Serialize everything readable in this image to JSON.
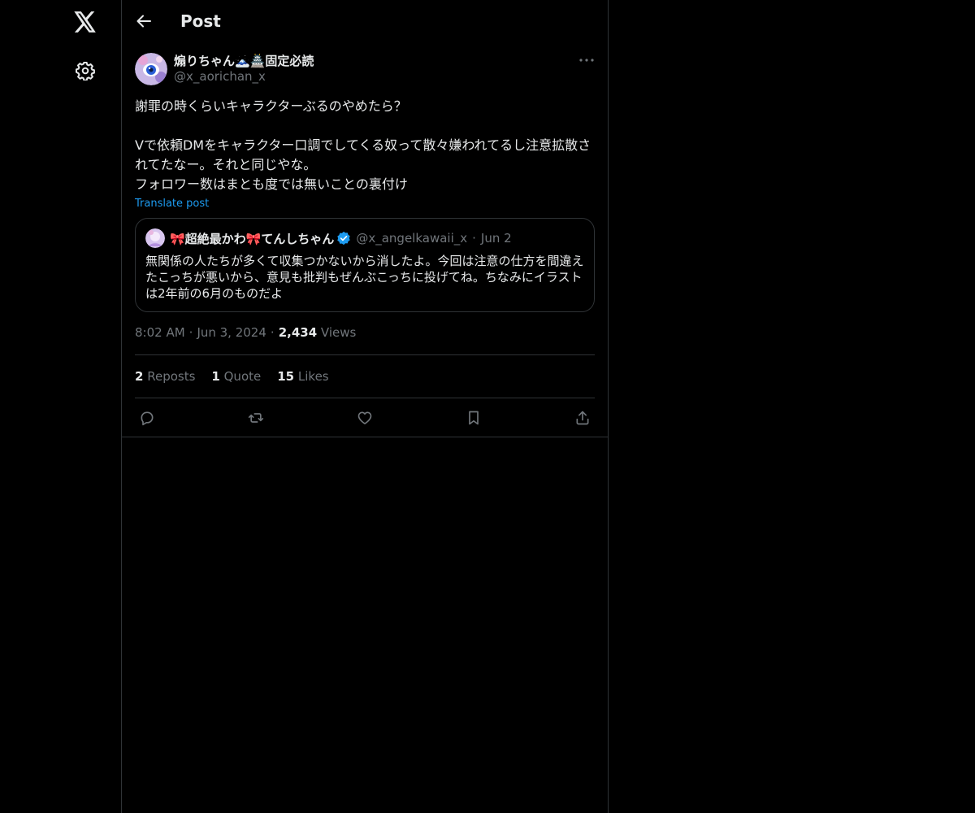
{
  "header": {
    "title": "Post"
  },
  "post": {
    "author_name": "煽りちゃん🗻🏯固定必読",
    "author_handle": "@x_aorichan_x",
    "text": "謝罪の時くらいキャラクターぶるのやめたら？\n\nVで依頼DMをキャラクター口調でしてくる奴って散々嫌われてるし注意拡散されてたなー。それと同じやな。\nフォロワー数はまとも度では無いことの裏付け",
    "translate_label": "Translate post",
    "time": "8:02 AM",
    "date": "Jun 3, 2024",
    "views_count": "2,434",
    "views_label": "Views"
  },
  "quote": {
    "author_name": "🎀超絶最かわ🎀てんしちゃん",
    "author_handle": "@x_angelkawaii_x",
    "dot": "·",
    "date": "Jun 2",
    "text": "無関係の人たちが多くて収集つかないから消したよ。今回は注意の仕方を間違えたこっちが悪いから、意見も批判もぜんぶこっちに投げてね。ちなみにイラストは2年前の6月のものだよ"
  },
  "stats": {
    "reposts_count": "2",
    "reposts_label": "Reposts",
    "quotes_count": "1",
    "quotes_label": "Quote",
    "likes_count": "15",
    "likes_label": "Likes"
  },
  "meta_sep": "·",
  "colors": {
    "background": "#000000",
    "accent": "#1d9bf0",
    "border": "#2f3336",
    "muted": "#71767b",
    "text": "#e7e9ea"
  },
  "icons": [
    "x-logo-icon",
    "gear-icon",
    "back-arrow-icon",
    "more-icon",
    "verified-badge-icon",
    "reply-icon",
    "repost-icon",
    "like-icon",
    "bookmark-icon",
    "share-icon"
  ]
}
